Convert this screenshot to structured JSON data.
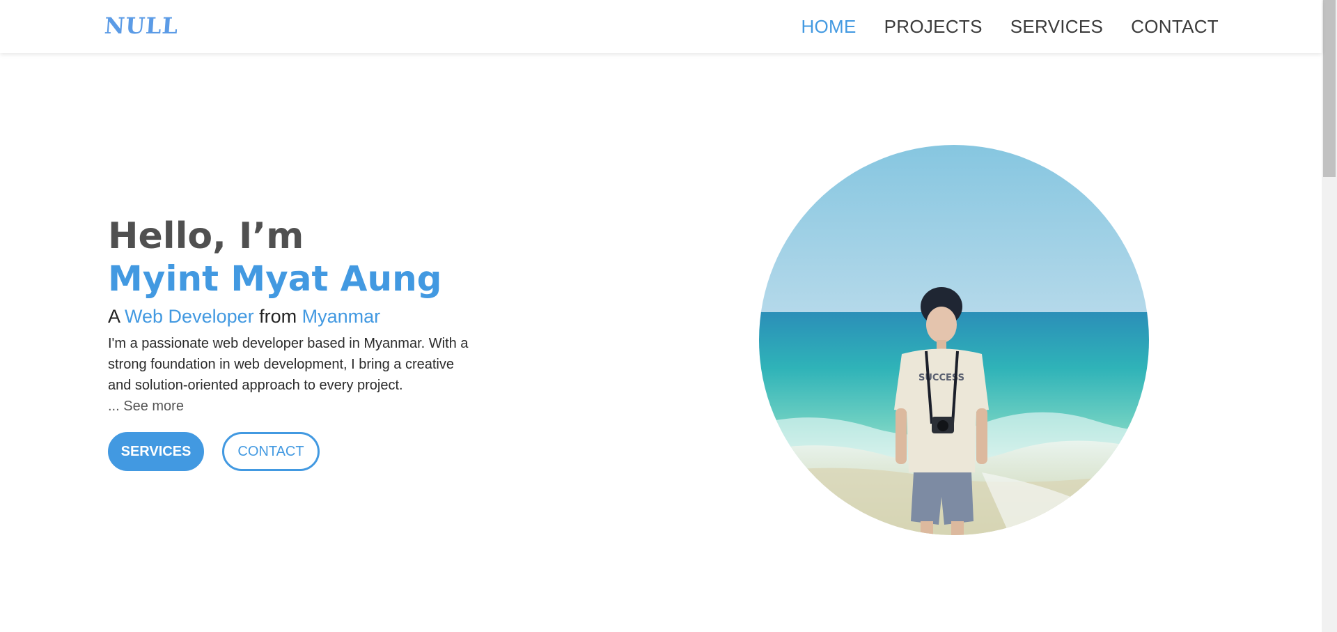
{
  "header": {
    "logo": "NULL",
    "nav": [
      {
        "label": "HOME",
        "active": true
      },
      {
        "label": "PROJECTS",
        "active": false
      },
      {
        "label": "SERVICES",
        "active": false
      },
      {
        "label": "CONTACT",
        "active": false
      }
    ]
  },
  "hero": {
    "greeting": "Hello, I’m",
    "name": "Myint Myat Aung",
    "tagline": {
      "prefix": "A ",
      "role": "Web Developer",
      "middle": " from ",
      "country": "Myanmar"
    },
    "bio": "I'm a passionate web developer based in Myanmar. With a strong foundation in web development, I bring a creative and solution-oriented approach to every project.",
    "see_more": "... See more",
    "buttons": {
      "primary": "SERVICES",
      "secondary": "CONTACT"
    },
    "photo": {
      "alt": "profile-photo",
      "shirt_text": "SUCCESS"
    }
  },
  "colors": {
    "accent": "#4299e1",
    "heading": "#505050",
    "text": "#222222"
  }
}
